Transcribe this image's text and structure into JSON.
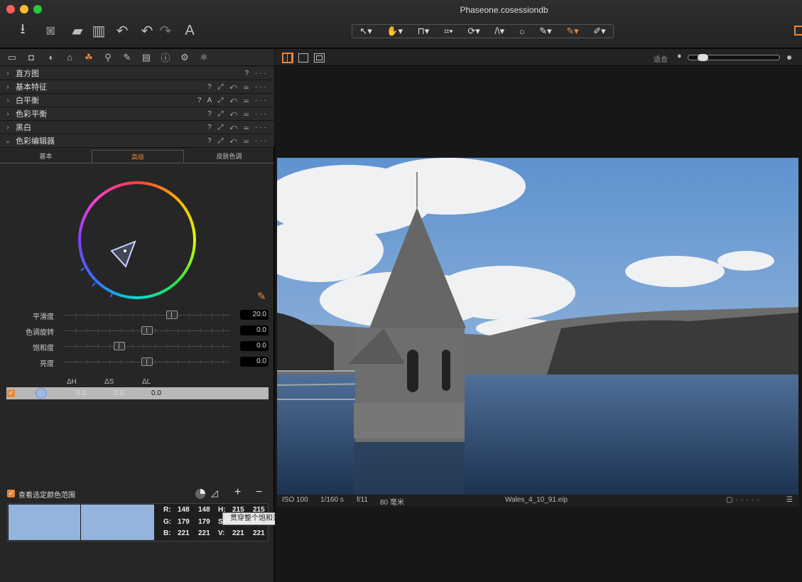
{
  "window": {
    "title": "Phaseone.cosessiondb"
  },
  "colors": {
    "accent": "#e8873a",
    "close": "#fe5f57",
    "minimize": "#febc2e",
    "maximize": "#28c840",
    "swatch": "#94b3dd",
    "panel_bg": "#262626"
  },
  "toolbar_icons": [
    "import-icon",
    "camera-icon",
    "folder-icon",
    "trash-icon",
    "undo-all-icon",
    "undo-icon",
    "redo-icon",
    "text-icon"
  ],
  "tool_group": [
    "select-tool",
    "pan-tool",
    "straighten-tool",
    "crop-tool",
    "rotate-tool",
    "keystone-tool",
    "circle-tool",
    "brush-tool",
    "color-picker-tool",
    "eraser-tool"
  ],
  "panel_tabs": [
    "library-tab",
    "capture-tab",
    "lens-tab",
    "composition-tab",
    "color-tab",
    "details-tab",
    "adjust-tab",
    "metadata-tab",
    "output-tab",
    "settings-tab",
    "batch-tab"
  ],
  "sections": [
    {
      "label": "直方图",
      "tools": "? ···",
      "open": false
    },
    {
      "label": "基本特征",
      "tools": "? ⤢ ↶ ☰ ···",
      "open": false
    },
    {
      "label": "白平衡",
      "tools": "? A ⤢ ↶ ☰ ···",
      "open": false
    },
    {
      "label": "色彩平衡",
      "tools": "? ⤢ ↶ ☰ ···",
      "open": false
    },
    {
      "label": "黑白",
      "tools": "? ⤢ ↶ ☰ ···",
      "open": false
    },
    {
      "label": "色彩编辑器",
      "tools": "? ⤢ ↶ ☰ ···",
      "open": true
    }
  ],
  "editor_tabs": {
    "basic": "基本",
    "advanced": "高级",
    "skin": "皮肤色调"
  },
  "sliders": [
    {
      "label": "平滑度",
      "value": "20.0",
      "pos": 0.65
    },
    {
      "label": "色调旋转",
      "value": "0.0",
      "pos": 0.5
    },
    {
      "label": "饱和度",
      "value": "0.0",
      "pos": 0.33
    },
    {
      "label": "亮度",
      "value": "0.0",
      "pos": 0.5
    }
  ],
  "delta_table": {
    "headers": [
      "ΔH",
      "ΔS",
      "ΔL"
    ],
    "values": [
      "0.0",
      "0.0",
      "0.0"
    ]
  },
  "view_selected": {
    "label": "查看选定颜色范围",
    "checked": true
  },
  "readout": {
    "R": [
      "148",
      "148"
    ],
    "G": [
      "179",
      "179"
    ],
    "B": [
      "221",
      "221"
    ],
    "H": "215",
    "H2": "215",
    "S_partial": "S",
    "V": [
      "221",
      "221"
    ]
  },
  "tooltip": "贯穿整个饱和范围",
  "viewer": {
    "fit_label": "适合"
  },
  "photo_info": {
    "iso": "ISO 100",
    "shutter": "1/160 s",
    "aperture": "f/11",
    "focal": "80 毫米",
    "filename": "Wales_4_10_91.eip"
  }
}
